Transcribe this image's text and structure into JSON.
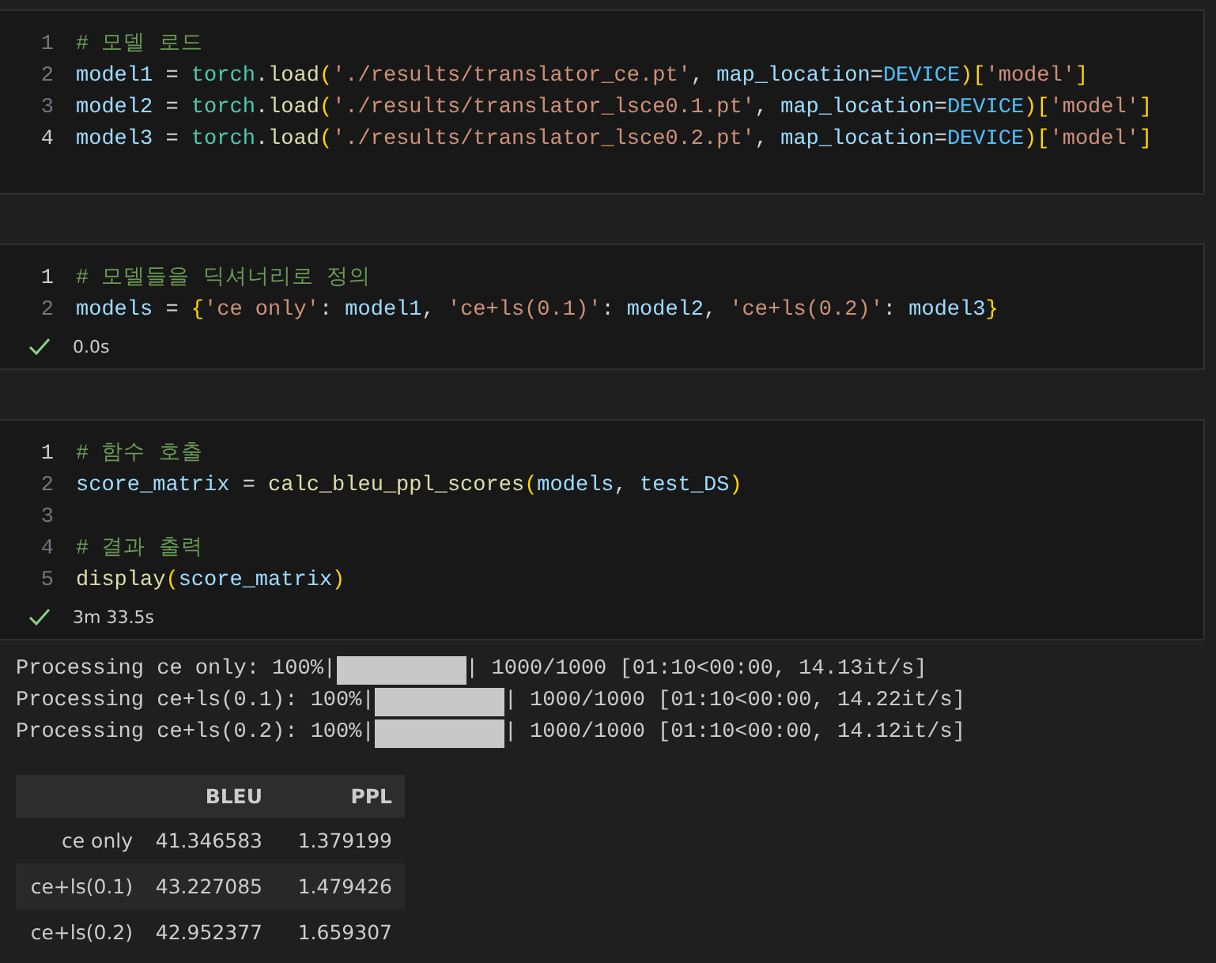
{
  "cells": [
    {
      "lines": [
        {
          "number": "1",
          "active": false,
          "tokens": [
            {
              "kind": "comment",
              "text": "# 모델 로드"
            }
          ]
        },
        {
          "number": "2",
          "active": false,
          "tokens": [
            {
              "kind": "var",
              "text": "model1"
            },
            {
              "kind": "op",
              "text": " = "
            },
            {
              "kind": "module",
              "text": "torch"
            },
            {
              "kind": "op",
              "text": "."
            },
            {
              "kind": "func",
              "text": "load"
            },
            {
              "kind": "bracket",
              "text": "("
            },
            {
              "kind": "str",
              "text": "'./results/translator_ce.pt'"
            },
            {
              "kind": "op",
              "text": ", "
            },
            {
              "kind": "var",
              "text": "map_location"
            },
            {
              "kind": "op",
              "text": "="
            },
            {
              "kind": "const",
              "text": "DEVICE"
            },
            {
              "kind": "bracket",
              "text": ")["
            },
            {
              "kind": "str",
              "text": "'model'"
            },
            {
              "kind": "bracket",
              "text": "]"
            }
          ]
        },
        {
          "number": "3",
          "active": false,
          "tokens": [
            {
              "kind": "var",
              "text": "model2"
            },
            {
              "kind": "op",
              "text": " = "
            },
            {
              "kind": "module",
              "text": "torch"
            },
            {
              "kind": "op",
              "text": "."
            },
            {
              "kind": "func",
              "text": "load"
            },
            {
              "kind": "bracket",
              "text": "("
            },
            {
              "kind": "str",
              "text": "'./results/translator_lsce0.1.pt'"
            },
            {
              "kind": "op",
              "text": ", "
            },
            {
              "kind": "var",
              "text": "map_location"
            },
            {
              "kind": "op",
              "text": "="
            },
            {
              "kind": "const",
              "text": "DEVICE"
            },
            {
              "kind": "bracket",
              "text": ")["
            },
            {
              "kind": "str",
              "text": "'model'"
            },
            {
              "kind": "bracket",
              "text": "]"
            }
          ]
        },
        {
          "number": "4",
          "active": true,
          "tokens": [
            {
              "kind": "var",
              "text": "model3"
            },
            {
              "kind": "op",
              "text": " = "
            },
            {
              "kind": "module",
              "text": "torch"
            },
            {
              "kind": "op",
              "text": "."
            },
            {
              "kind": "func",
              "text": "load"
            },
            {
              "kind": "bracket",
              "text": "("
            },
            {
              "kind": "str",
              "text": "'./results/translator_lsce0.2.pt'"
            },
            {
              "kind": "op",
              "text": ", "
            },
            {
              "kind": "var",
              "text": "map_location"
            },
            {
              "kind": "op",
              "text": "="
            },
            {
              "kind": "const",
              "text": "DEVICE"
            },
            {
              "kind": "bracket",
              "text": ")["
            },
            {
              "kind": "str",
              "text": "'model'"
            },
            {
              "kind": "bracket",
              "text": "]"
            }
          ]
        }
      ]
    },
    {
      "lines": [
        {
          "number": "1",
          "active": true,
          "tokens": [
            {
              "kind": "comment",
              "text": "# 모델들을 딕셔너리로 정의"
            }
          ]
        },
        {
          "number": "2",
          "active": false,
          "tokens": [
            {
              "kind": "var",
              "text": "models"
            },
            {
              "kind": "op",
              "text": " = "
            },
            {
              "kind": "bracket",
              "text": "{"
            },
            {
              "kind": "str",
              "text": "'ce only'"
            },
            {
              "kind": "op",
              "text": ": "
            },
            {
              "kind": "var",
              "text": "model1"
            },
            {
              "kind": "op",
              "text": ", "
            },
            {
              "kind": "str",
              "text": "'ce+ls(0.1)'"
            },
            {
              "kind": "op",
              "text": ": "
            },
            {
              "kind": "var",
              "text": "model2"
            },
            {
              "kind": "op",
              "text": ", "
            },
            {
              "kind": "str",
              "text": "'ce+ls(0.2)'"
            },
            {
              "kind": "op",
              "text": ": "
            },
            {
              "kind": "var",
              "text": "model3"
            },
            {
              "kind": "bracket",
              "text": "}"
            }
          ]
        }
      ],
      "status": "0.0s"
    },
    {
      "lines": [
        {
          "number": "1",
          "active": true,
          "tokens": [
            {
              "kind": "comment",
              "text": "# 함수 호출"
            }
          ]
        },
        {
          "number": "2",
          "active": false,
          "tokens": [
            {
              "kind": "var",
              "text": "score_matrix"
            },
            {
              "kind": "op",
              "text": " = "
            },
            {
              "kind": "func",
              "text": "calc_bleu_ppl_scores"
            },
            {
              "kind": "bracket",
              "text": "("
            },
            {
              "kind": "var",
              "text": "models"
            },
            {
              "kind": "op",
              "text": ", "
            },
            {
              "kind": "var",
              "text": "test_DS"
            },
            {
              "kind": "bracket",
              "text": ")"
            }
          ]
        },
        {
          "number": "3",
          "active": false
        },
        {
          "number": "4",
          "active": false,
          "tokens": [
            {
              "kind": "comment",
              "text": "# 결과 출력"
            }
          ]
        },
        {
          "number": "5",
          "active": false,
          "tokens": [
            {
              "kind": "func",
              "text": "display"
            },
            {
              "kind": "bracket",
              "text": "("
            },
            {
              "kind": "var",
              "text": "score_matrix"
            },
            {
              "kind": "bracket",
              "text": ")"
            }
          ]
        }
      ],
      "status": "3m 33.5s"
    }
  ],
  "output": {
    "progress": [
      {
        "prefix": "Processing ce only: 100%|",
        "level": 1,
        "suffix": "| 1000/1000 [01:10<00:00, 14.13it/s]"
      },
      {
        "prefix": "Processing ce+ls(0.1): 100%|",
        "level": 1,
        "suffix": "| 1000/1000 [01:10<00:00, 14.22it/s]"
      },
      {
        "prefix": "Processing ce+ls(0.2): 100%|",
        "level": 1,
        "suffix": "| 1000/1000 [01:10<00:00, 14.12it/s]"
      }
    ],
    "table": {
      "columns": [
        "BLEU",
        "PPL"
      ],
      "rows": [
        {
          "label": "ce only",
          "cells": [
            "41.346583",
            "1.379199"
          ]
        },
        {
          "label": "ce+ls(0.1)",
          "cells": [
            "43.227085",
            "1.479426"
          ]
        },
        {
          "label": "ce+ls(0.2)",
          "cells": [
            "42.952377",
            "1.659307"
          ]
        }
      ]
    }
  }
}
